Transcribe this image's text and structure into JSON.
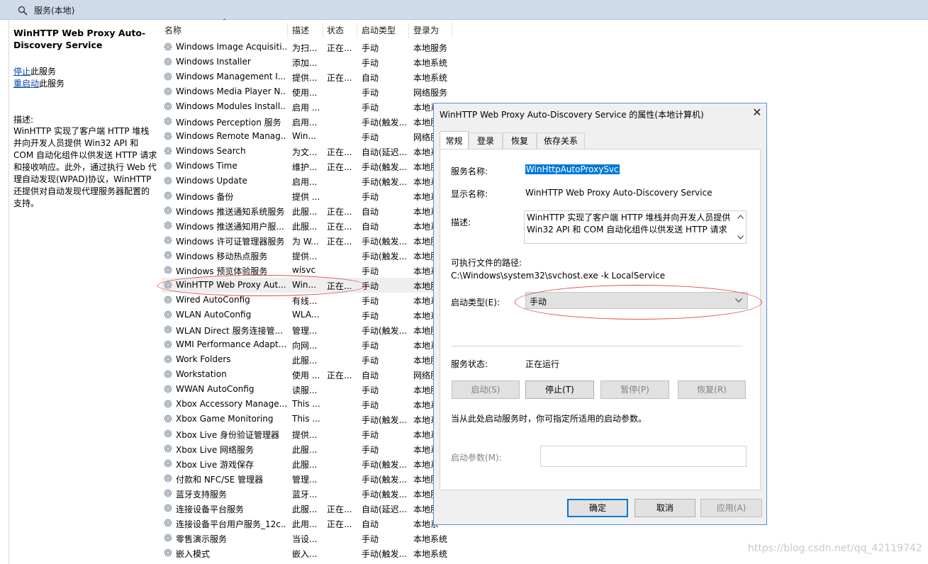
{
  "window": {
    "breadcrumb": "服务(本地)"
  },
  "left_pane": {
    "service_title": "WinHTTP Web Proxy Auto-Discovery Service",
    "stop_link": "停止",
    "stop_suffix": "此服务",
    "restart_link": "重启动",
    "restart_suffix": "此服务",
    "desc_label": "描述:",
    "desc_text": "WinHTTP 实现了客户端 HTTP 堆栈并向开发人员提供 Win32 API 和 COM 自动化组件以供发送 HTTP 请求和接收响应。此外，通过执行 Web 代理自动发现(WPAD)协议，WinHTTP 还提供对自动发现代理服务器配置的支持。"
  },
  "list": {
    "columns": {
      "name": "名称",
      "desc": "描述",
      "status": "状态",
      "startup": "启动类型",
      "logon": "登录为"
    },
    "rows": [
      {
        "name": "Windows Image Acquisiti...",
        "desc": "为扫...",
        "status": "正在...",
        "startup": "手动",
        "logon": "本地服务"
      },
      {
        "name": "Windows Installer",
        "desc": "添加...",
        "status": "",
        "startup": "手动",
        "logon": "本地系统"
      },
      {
        "name": "Windows Management I...",
        "desc": "提供...",
        "status": "正在...",
        "startup": "自动",
        "logon": "本地系统"
      },
      {
        "name": "Windows Media Player N...",
        "desc": "使用...",
        "status": "",
        "startup": "手动",
        "logon": "网络服务"
      },
      {
        "name": "Windows Modules Install...",
        "desc": "启用 ...",
        "status": "",
        "startup": "手动",
        "logon": "本地系"
      },
      {
        "name": "Windows Perception 服务",
        "desc": "启用...",
        "status": "",
        "startup": "手动(触发...",
        "logon": "本地服"
      },
      {
        "name": "Windows Remote Manag...",
        "desc": "Win...",
        "status": "",
        "startup": "手动",
        "logon": "网络服"
      },
      {
        "name": "Windows Search",
        "desc": "为文...",
        "status": "正在...",
        "startup": "自动(延迟...",
        "logon": "本地系"
      },
      {
        "name": "Windows Time",
        "desc": "维护...",
        "status": "正在...",
        "startup": "手动(触发...",
        "logon": "本地服"
      },
      {
        "name": "Windows Update",
        "desc": "启用...",
        "status": "",
        "startup": "手动(触发...",
        "logon": "本地系"
      },
      {
        "name": "Windows 备份",
        "desc": "提供 ...",
        "status": "",
        "startup": "手动",
        "logon": "本地系"
      },
      {
        "name": "Windows 推送通知系统服务",
        "desc": "此服...",
        "status": "正在...",
        "startup": "自动",
        "logon": "本地系"
      },
      {
        "name": "Windows 推送通知用户服...",
        "desc": "此服...",
        "status": "正在...",
        "startup": "自动",
        "logon": "本地系"
      },
      {
        "name": "Windows 许可证管理器服务",
        "desc": "为 W...",
        "status": "正在...",
        "startup": "手动(触发...",
        "logon": "本地服"
      },
      {
        "name": "Windows 移动热点服务",
        "desc": "提供...",
        "status": "",
        "startup": "手动(触发...",
        "logon": "本地服"
      },
      {
        "name": "Windows 预览体验服务",
        "desc": "wisvc",
        "status": "",
        "startup": "手动",
        "logon": "本地系"
      },
      {
        "name": "WinHTTP Web Proxy Aut...",
        "desc": "Win...",
        "status": "正在...",
        "startup": "手动",
        "logon": "本地服"
      },
      {
        "name": "Wired AutoConfig",
        "desc": "有线...",
        "status": "",
        "startup": "手动",
        "logon": "本地系"
      },
      {
        "name": "WLAN AutoConfig",
        "desc": "WLA...",
        "status": "",
        "startup": "手动",
        "logon": "本地系"
      },
      {
        "name": "WLAN Direct 服务连接管...",
        "desc": "管理...",
        "status": "",
        "startup": "手动(触发...",
        "logon": "本地服"
      },
      {
        "name": "WMI Performance Adapt...",
        "desc": "向网...",
        "status": "",
        "startup": "手动",
        "logon": "本地系"
      },
      {
        "name": "Work Folders",
        "desc": "此服...",
        "status": "",
        "startup": "手动",
        "logon": "本地服"
      },
      {
        "name": "Workstation",
        "desc": "使用 ...",
        "status": "正在...",
        "startup": "自动",
        "logon": "网络服"
      },
      {
        "name": "WWAN AutoConfig",
        "desc": "读服...",
        "status": "",
        "startup": "手动",
        "logon": "本地服"
      },
      {
        "name": "Xbox Accessory Manage...",
        "desc": "This ...",
        "status": "",
        "startup": "手动",
        "logon": "本地系"
      },
      {
        "name": "Xbox Game Monitoring",
        "desc": "This ...",
        "status": "",
        "startup": "手动(触发...",
        "logon": "本地系"
      },
      {
        "name": "Xbox Live 身份验证管理器",
        "desc": "提供...",
        "status": "",
        "startup": "手动",
        "logon": "本地系"
      },
      {
        "name": "Xbox Live 网络服务",
        "desc": "此服...",
        "status": "",
        "startup": "手动",
        "logon": "本地系"
      },
      {
        "name": "Xbox Live 游戏保存",
        "desc": "此服...",
        "status": "",
        "startup": "手动(触发...",
        "logon": "本地系"
      },
      {
        "name": "付款和 NFC/SE 管理器",
        "desc": "管理...",
        "status": "",
        "startup": "手动(触发...",
        "logon": "本地服"
      },
      {
        "name": "蓝牙支持服务",
        "desc": "蓝牙...",
        "status": "",
        "startup": "手动(触发...",
        "logon": "本地服"
      },
      {
        "name": "连接设备平台服务",
        "desc": "此服...",
        "status": "正在...",
        "startup": "自动(延迟...",
        "logon": "本地服"
      },
      {
        "name": "连接设备平台用户服务_12c...",
        "desc": "此用...",
        "status": "正在...",
        "startup": "自动",
        "logon": "本地系"
      },
      {
        "name": "零售演示服务",
        "desc": "当设...",
        "status": "",
        "startup": "手动",
        "logon": "本地系统"
      },
      {
        "name": "嵌入模式",
        "desc": "嵌入...",
        "status": "",
        "startup": "手动(触发...",
        "logon": "本地系统"
      }
    ]
  },
  "dialog": {
    "title": "WinHTTP Web Proxy Auto-Discovery Service 的属性(本地计算机)",
    "tabs": [
      "常规",
      "登录",
      "恢复",
      "依存关系"
    ],
    "service_name_label": "服务名称:",
    "service_name": "WinHttpAutoProxySvc",
    "display_name_label": "显示名称:",
    "display_name": "WinHTTP Web Proxy Auto-Discovery Service",
    "desc_label": "描述:",
    "desc_text": "WinHTTP 实现了客户端 HTTP 堆栈并向开发人员提供 Win32 API 和 COM 自动化组件以供发送 HTTP 请求",
    "exe_path_label": "可执行文件的路径:",
    "exe_path": "C:\\Windows\\system32\\svchost.exe -k LocalService",
    "startup_type_label": "启动类型(E):",
    "startup_type": "手动",
    "status_label": "服务状态:",
    "status_value": "正在运行",
    "start_btn": "启动(S)",
    "stop_btn": "停止(T)",
    "pause_btn": "暂停(P)",
    "resume_btn": "恢复(R)",
    "hint": "当从此处启动服务时，你可指定所适用的启动参数。",
    "params_label": "启动参数(M):",
    "params_value": "",
    "ok_btn": "确定",
    "cancel_btn": "取消",
    "apply_btn": "应用(A)"
  },
  "watermark": "https://blog.csdn.net/qq_42119742",
  "colors": {
    "accent": "#0078d7",
    "annotation": "#e05050",
    "topbar": "#cfdbea"
  }
}
